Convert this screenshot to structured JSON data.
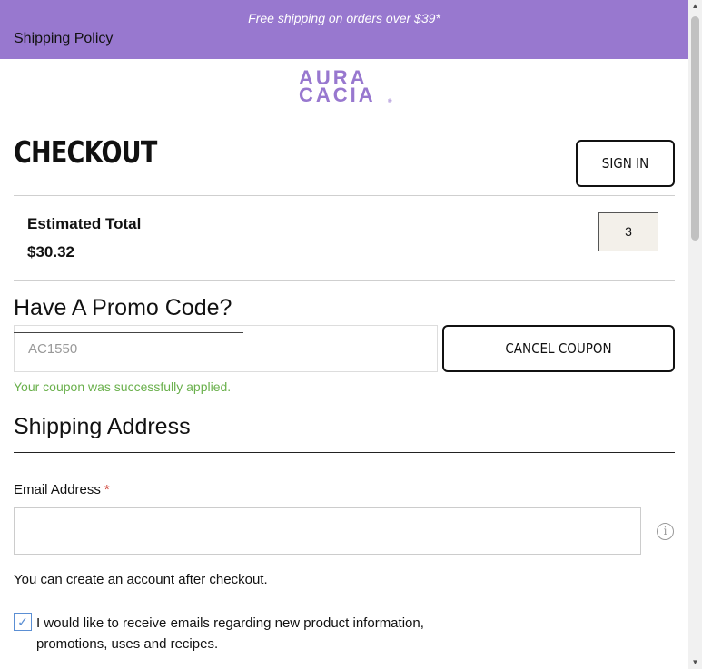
{
  "banner": {
    "promo": "Free shipping on orders over $39*",
    "shipping_policy": "Shipping Policy"
  },
  "logo": {
    "line1": "AURA",
    "line2": "CACIA",
    "reg": "®"
  },
  "checkout": {
    "title": "CHECKOUT",
    "sign_in": "SIGN IN"
  },
  "summary": {
    "estimated_total_label": "Estimated Total",
    "estimated_total_value": "$30.32",
    "item_count": "3"
  },
  "promo": {
    "heading": "Have A Promo Code?",
    "input_value": "AC1550",
    "cancel_coupon": "CANCEL COUPON",
    "success_message": "Your coupon was successfully applied."
  },
  "shipping": {
    "heading": "Shipping Address",
    "email_label": "Email Address",
    "required_marker": "*",
    "email_value": "",
    "info_icon": "info-icon",
    "account_note": "You can create an account after checkout.",
    "newsletter_checked": true,
    "newsletter_label": "I would like to receive emails regarding new product information, promotions, uses and recipes."
  },
  "colors": {
    "brand_purple": "#9878cf",
    "success_green": "#6ab04c",
    "required_red": "#d0463b"
  }
}
